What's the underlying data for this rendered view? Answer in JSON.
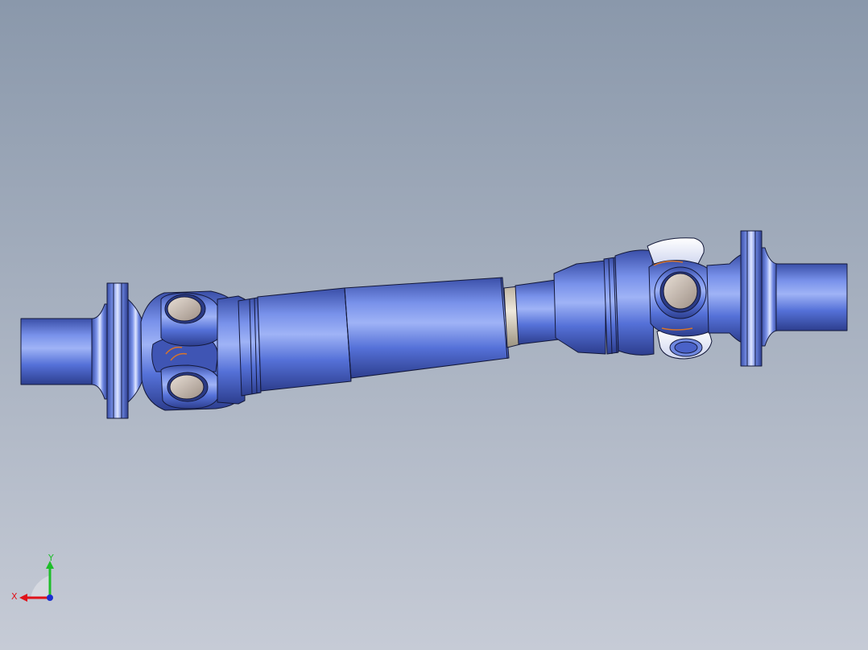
{
  "viewport": {
    "model": "drive-shaft-assembly",
    "background_top": "#8a98ab",
    "background_bottom": "#c6cbd6"
  },
  "colors": {
    "part_dark": "#2f4290",
    "part_mid": "#4f6ad6",
    "part_light": "#8fa6f0",
    "part_highlight": "#dfe6ff",
    "bearing_cap": "#c9bcb1",
    "spacer": "#d9d2c2",
    "edge": "#14193a",
    "axis_x": "#e0121a",
    "axis_y": "#1ebd2a",
    "axis_z": "#1a2fd0"
  },
  "triad": {
    "x_label": "X",
    "y_label": "Y"
  }
}
